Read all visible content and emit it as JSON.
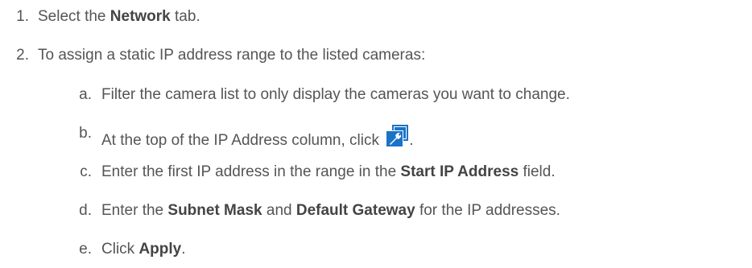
{
  "steps": [
    {
      "number": "1.",
      "prefix": "Select the ",
      "bold": "Network",
      "suffix": " tab."
    },
    {
      "number": "2.",
      "text": "To assign a static IP address range to the listed cameras:"
    }
  ],
  "substeps": [
    {
      "letter": "a.",
      "text": "Filter the camera list to only display the cameras you want to change."
    },
    {
      "letter": "b.",
      "prefix": "At the top of the IP Address column, click ",
      "icon": "edit-wrench-icon",
      "suffix": "."
    },
    {
      "letter": "c.",
      "prefix": "Enter the first IP address in the range in the ",
      "bold": "Start IP Address",
      "suffix": " field."
    },
    {
      "letter": "d.",
      "prefix": "Enter the ",
      "bold1": "Subnet Mask",
      "middle": " and ",
      "bold2": "Default Gateway",
      "suffix": " for the IP addresses."
    },
    {
      "letter": "e.",
      "prefix": "Click ",
      "bold": "Apply",
      "suffix": "."
    }
  ],
  "colors": {
    "text": "#555555",
    "icon_blue": "#1a73c7"
  }
}
